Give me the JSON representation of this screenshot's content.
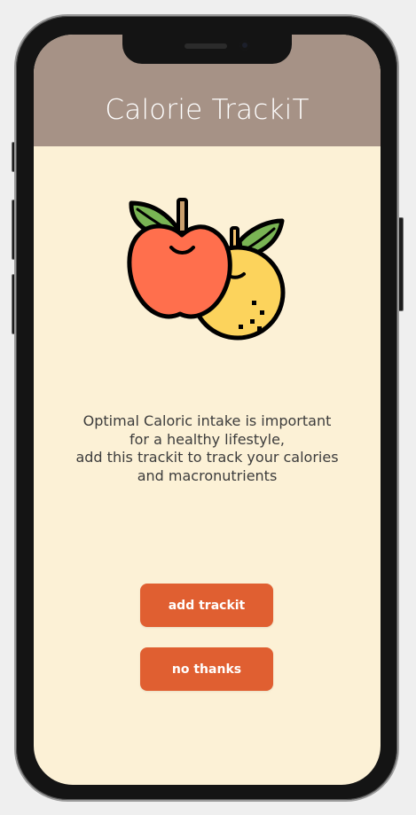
{
  "header": {
    "title": "Calorie TrackiT"
  },
  "illustration": {
    "icon": "fruit-apple-orange-icon"
  },
  "description": {
    "lines": [
      "Optimal Caloric intake is important",
      "for a healthy lifestyle,",
      "add this trackit to track your calories",
      "and macronutrients"
    ]
  },
  "actions": {
    "add_label": "add trackit",
    "decline_label": "no thanks"
  },
  "colors": {
    "header": "#a69286",
    "background": "#fcf1d6",
    "button": "#e05f31",
    "title": "#ffffff",
    "body_text": "#3c3c3c"
  }
}
